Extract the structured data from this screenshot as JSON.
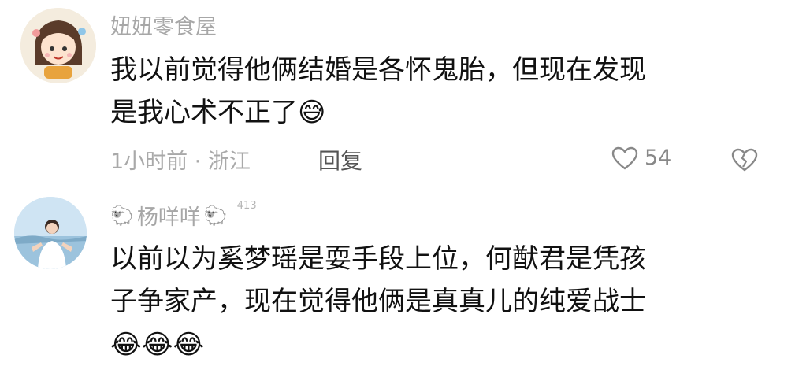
{
  "comments": [
    {
      "username": "妞妞零食屋",
      "lines": [
        "我以前觉得他俩结婚是各怀鬼胎，但现在发现",
        "是我心术不正了"
      ],
      "emoji": [
        "😅"
      ],
      "meta": "1小时前 · 浙江",
      "reply_label": "回复",
      "like_count": "54",
      "icons": {
        "avatar": "cartoon-girl-avatar",
        "like": "heart-icon",
        "dislike": "broken-heart-icon"
      }
    },
    {
      "username": "杨咩咩",
      "name_decorations": [
        "🐑",
        "🐑"
      ],
      "level": "413",
      "lines": [
        "以前以为奚梦瑶是耍手段上位，何猷君是凭孩",
        "子争家产，现在觉得他俩是真真儿的纯爱战士"
      ],
      "emoji": [
        "😂",
        "😂",
        "😂"
      ],
      "icons": {
        "avatar": "photo-avatar"
      }
    }
  ],
  "colors": {
    "text": "#111111",
    "muted": "#a7a7a7",
    "reply": "#555555"
  }
}
